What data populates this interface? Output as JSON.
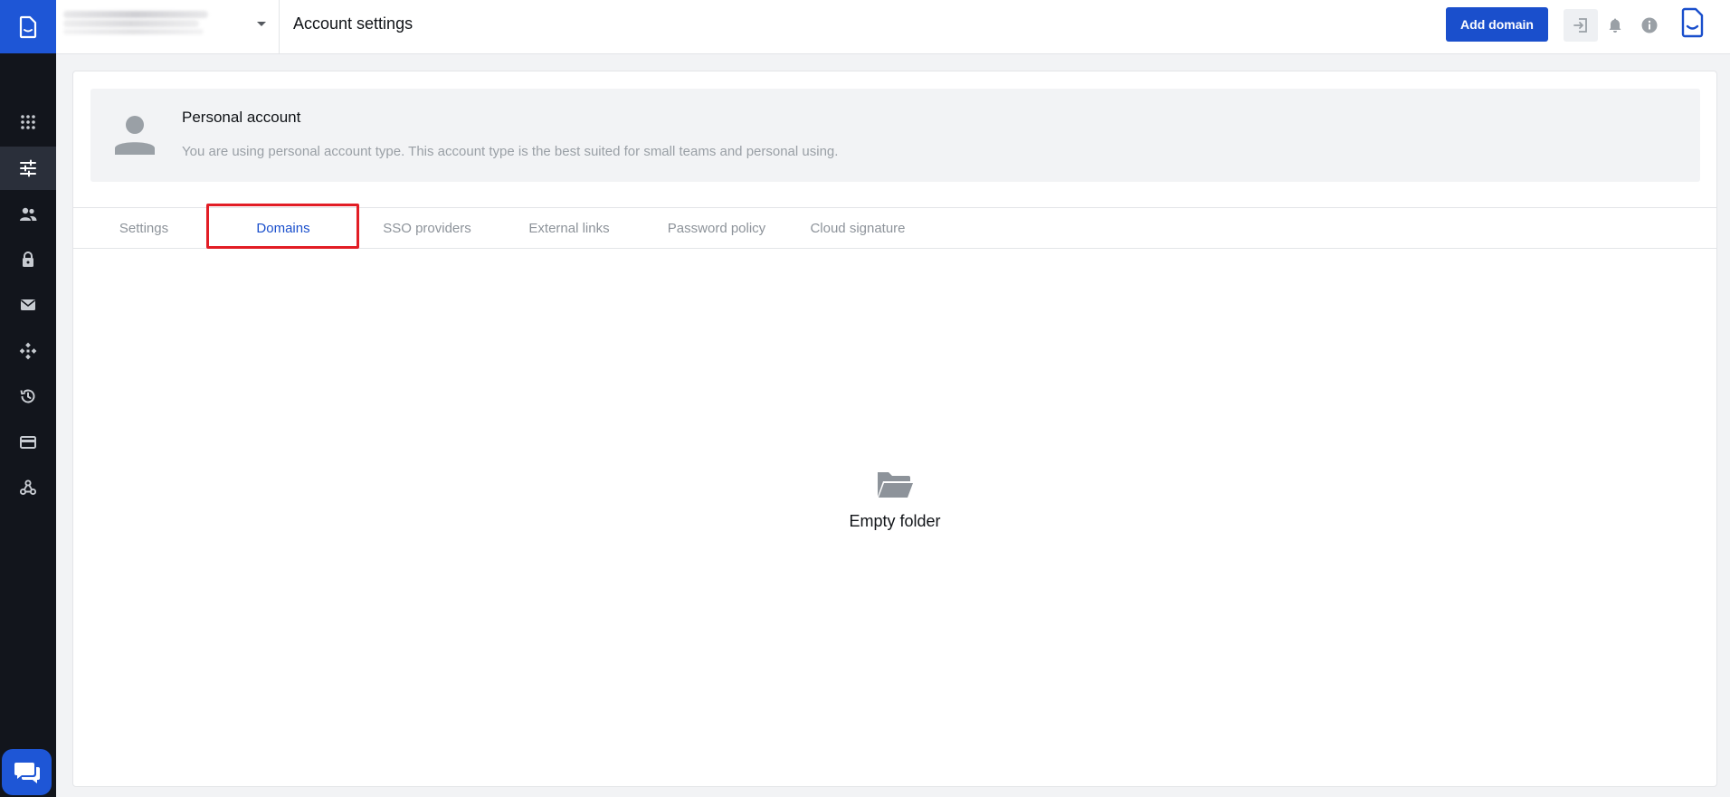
{
  "app": {
    "page_title": "Account settings",
    "accent_color": "#1a4fcc",
    "sidebar_bg": "#12151c"
  },
  "sidebar": {
    "logo_icon": "document-logo-icon",
    "items": [
      {
        "icon": "apps-grid-icon",
        "active": false
      },
      {
        "icon": "sliders-settings-icon",
        "active": true
      },
      {
        "icon": "users-icon",
        "active": false
      },
      {
        "icon": "lock-icon",
        "active": false
      },
      {
        "icon": "mail-icon",
        "active": false
      },
      {
        "icon": "integrations-icon",
        "active": false
      },
      {
        "icon": "history-icon",
        "active": false
      },
      {
        "icon": "credit-card-icon",
        "active": false
      },
      {
        "icon": "webhook-icon",
        "active": false
      }
    ],
    "chat_icon": "chat-icon"
  },
  "topbar": {
    "add_domain_label": "Add domain",
    "icons": [
      "sign-in-icon",
      "bell-icon",
      "info-icon",
      "document-brand-icon"
    ]
  },
  "banner": {
    "title": "Personal account",
    "description": "You are using personal account type. This account type is the best suited for small teams and personal using."
  },
  "tabs": [
    {
      "label": "Settings",
      "active": false
    },
    {
      "label": "Domains",
      "active": true
    },
    {
      "label": "SSO providers",
      "active": false
    },
    {
      "label": "External links",
      "active": false
    },
    {
      "label": "Password policy",
      "active": false
    },
    {
      "label": "Cloud signature",
      "active": false
    }
  ],
  "empty_state": {
    "icon": "open-folder-icon",
    "label": "Empty folder"
  }
}
